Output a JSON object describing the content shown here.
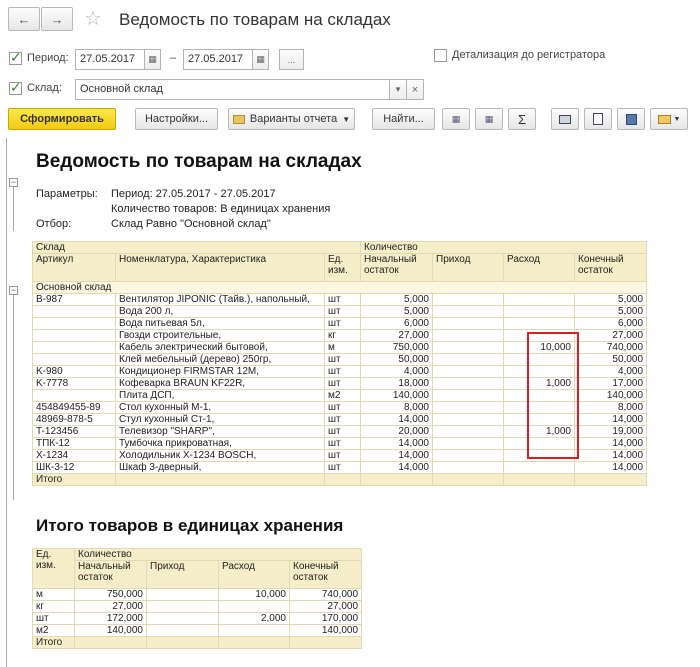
{
  "window": {
    "title": "Ведомость по товарам на складах",
    "back_icon": "arrow-left",
    "forward_icon": "arrow-right",
    "favorite_icon": "star"
  },
  "filters": {
    "period_label": "Период:",
    "period_from": "27.05.2017",
    "period_to": "27.05.2017",
    "period_dash": "–",
    "period_more": "...",
    "detail_label": "Детализация до регистратора",
    "warehouse_label": "Склад:",
    "warehouse_value": "Основной склад",
    "warehouse_dropdown": "▾",
    "warehouse_clear": "×"
  },
  "toolbar": {
    "generate": "Сформировать",
    "settings": "Настройки...",
    "variants": "Варианты отчета",
    "find": "Найти..."
  },
  "report": {
    "title": "Ведомость по товарам на складах",
    "params_label": "Параметры:",
    "param_period": "Период: 27.05.2017 - 27.05.2017",
    "param_qty": "Количество товаров: В единицах хранения",
    "filter_label": "Отбор:",
    "filter_value": "Склад Равно \"Основной склад\"",
    "headers": {
      "warehouse": "Склад",
      "quantity": "Количество",
      "article": "Артикул",
      "nomenclature": "Номенклатура, Характеристика",
      "unit": "Ед. изм.",
      "opening": "Начальный остаток",
      "income": "Приход",
      "expense": "Расход",
      "closing": "Конечный остаток"
    },
    "group": "Основной склад",
    "rows": [
      {
        "article": "B-987",
        "name": "Вентилятор JIPONIC (Тайв.), напольный,",
        "unit": "шт",
        "opening": "5,000",
        "income": "",
        "expense": "",
        "closing": "5,000"
      },
      {
        "article": "",
        "name": "Вода 200 л,",
        "unit": "шт",
        "opening": "5,000",
        "income": "",
        "expense": "",
        "closing": "5,000"
      },
      {
        "article": "",
        "name": "Вода питьевая 5л,",
        "unit": "шт",
        "opening": "6,000",
        "income": "",
        "expense": "",
        "closing": "6,000"
      },
      {
        "article": "",
        "name": "Гвозди строительные,",
        "unit": "кг",
        "opening": "27,000",
        "income": "",
        "expense": "",
        "closing": "27,000"
      },
      {
        "article": "",
        "name": "Кабель электрический бытовой,",
        "unit": "м",
        "opening": "750,000",
        "income": "",
        "expense": "10,000",
        "closing": "740,000"
      },
      {
        "article": "",
        "name": "Клей мебельный (дерево) 250гр,",
        "unit": "шт",
        "opening": "50,000",
        "income": "",
        "expense": "",
        "closing": "50,000"
      },
      {
        "article": "K-980",
        "name": "Кондиционер FIRMSTAR 12M,",
        "unit": "шт",
        "opening": "4,000",
        "income": "",
        "expense": "",
        "closing": "4,000"
      },
      {
        "article": "K-7778",
        "name": "Кофеварка BRAUN KF22R,",
        "unit": "шт",
        "opening": "18,000",
        "income": "",
        "expense": "1,000",
        "closing": "17,000"
      },
      {
        "article": "",
        "name": "Плита ДСП,",
        "unit": "м2",
        "opening": "140,000",
        "income": "",
        "expense": "",
        "closing": "140,000"
      },
      {
        "article": "454849455-89",
        "name": "Стол кухонный М-1,",
        "unit": "шт",
        "opening": "8,000",
        "income": "",
        "expense": "",
        "closing": "8,000"
      },
      {
        "article": "48969-878-5",
        "name": "Стул кухонный Ст-1,",
        "unit": "шт",
        "opening": "14,000",
        "income": "",
        "expense": "",
        "closing": "14,000"
      },
      {
        "article": "T-123456",
        "name": "Телевизор \"SHARP\",",
        "unit": "шт",
        "opening": "20,000",
        "income": "",
        "expense": "1,000",
        "closing": "19,000"
      },
      {
        "article": "ТПК-12",
        "name": "Тумбочка прикроватная,",
        "unit": "шт",
        "opening": "14,000",
        "income": "",
        "expense": "",
        "closing": "14,000"
      },
      {
        "article": "X-1234",
        "name": "Холодильник X-1234 BOSCH,",
        "unit": "шт",
        "opening": "14,000",
        "income": "",
        "expense": "",
        "closing": "14,000"
      },
      {
        "article": "ШК-3-12",
        "name": "Шкаф 3-дверный,",
        "unit": "шт",
        "opening": "14,000",
        "income": "",
        "expense": "",
        "closing": "14,000"
      }
    ],
    "total": "Итого"
  },
  "summary": {
    "title": "Итого товаров в единицах хранения",
    "headers": {
      "unit": "Ед. изм.",
      "quantity": "Количество",
      "opening": "Начальный остаток",
      "income": "Приход",
      "expense": "Расход",
      "closing": "Конечный остаток"
    },
    "rows": [
      {
        "unit": "м",
        "opening": "750,000",
        "income": "",
        "expense": "10,000",
        "closing": "740,000"
      },
      {
        "unit": "кг",
        "opening": "27,000",
        "income": "",
        "expense": "",
        "closing": "27,000"
      },
      {
        "unit": "шт",
        "opening": "172,000",
        "income": "",
        "expense": "2,000",
        "closing": "170,000"
      },
      {
        "unit": "м2",
        "opening": "140,000",
        "income": "",
        "expense": "",
        "closing": "140,000"
      }
    ],
    "total": "Итого"
  },
  "colors": {
    "primary_button": "#f2ca12",
    "header_bg": "#f6eec8",
    "highlight_border": "#d42020"
  }
}
